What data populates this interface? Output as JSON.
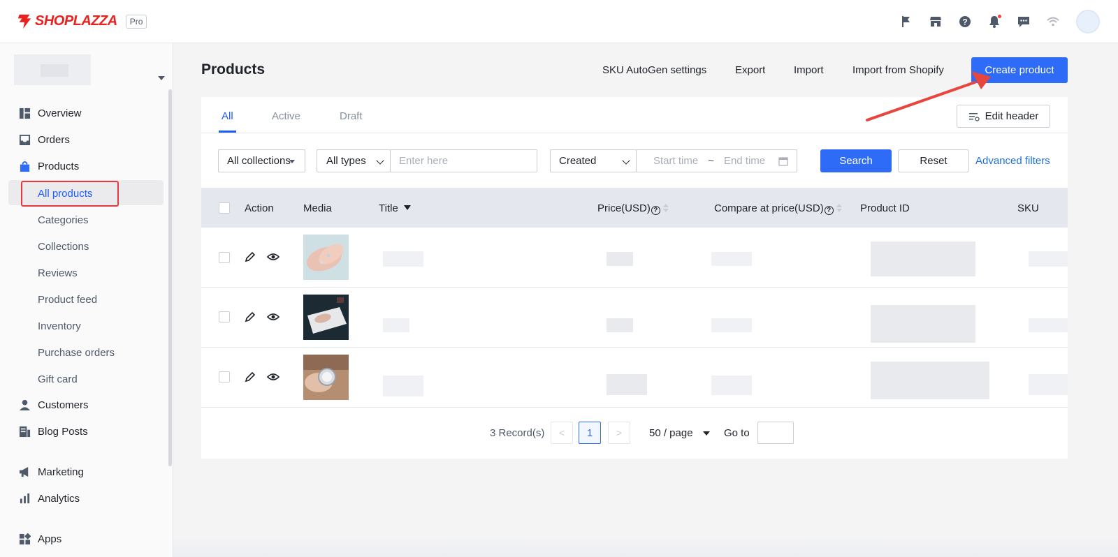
{
  "brand": {
    "name": "SHOPLAZZA",
    "badge": "Pro",
    "color": "#e8231f"
  },
  "topbar": {
    "icons": [
      "flag-icon",
      "store-icon",
      "help-icon",
      "bell-icon",
      "chat-icon",
      "wifi-icon"
    ]
  },
  "sidebar": {
    "items": [
      {
        "label": "Overview",
        "icon": "dashboard-icon"
      },
      {
        "label": "Orders",
        "icon": "inbox-icon"
      },
      {
        "label": "Products",
        "icon": "bag-icon"
      },
      {
        "label": "Customers",
        "icon": "person-icon"
      },
      {
        "label": "Blog Posts",
        "icon": "document-icon"
      },
      {
        "label": "Marketing",
        "icon": "megaphone-icon"
      },
      {
        "label": "Analytics",
        "icon": "bar-chart-icon"
      },
      {
        "label": "Apps",
        "icon": "apps-icon"
      }
    ],
    "sub_items": [
      {
        "label": "All products",
        "active": true
      },
      {
        "label": "Categories"
      },
      {
        "label": "Collections"
      },
      {
        "label": "Reviews"
      },
      {
        "label": "Product feed"
      },
      {
        "label": "Inventory"
      },
      {
        "label": "Purchase orders"
      },
      {
        "label": "Gift card"
      }
    ]
  },
  "header": {
    "title": "Products",
    "links": [
      "SKU AutoGen settings",
      "Export",
      "Import",
      "Import from Shopify"
    ],
    "create_label": "Create product",
    "accent": "#2e6bf6"
  },
  "tabs": [
    {
      "label": "All",
      "active": true
    },
    {
      "label": "Active"
    },
    {
      "label": "Draft"
    }
  ],
  "edit_header_label": "Edit header",
  "filters": {
    "collections": "All collections",
    "types": "All types",
    "search_placeholder": "Enter here",
    "date_field": "Created",
    "start_placeholder": "Start time",
    "separator": "~",
    "end_placeholder": "End time",
    "search_label": "Search",
    "reset_label": "Reset",
    "advanced_label": "Advanced filters"
  },
  "table": {
    "columns": {
      "action": "Action",
      "media": "Media",
      "title": "Title",
      "price": "Price(USD)",
      "compare": "Compare at price(USD)",
      "product_id": "Product ID",
      "sku": "SKU",
      "help_glyph": "?"
    },
    "rows": [
      {
        "media": "hands-rings-photo"
      },
      {
        "media": "hand-laptop-photo"
      },
      {
        "media": "wrist-watch-photo"
      }
    ]
  },
  "pagination": {
    "records": "3 Record(s)",
    "prev": "<",
    "current": "1",
    "next": ">",
    "per_page": "50 / page",
    "goto_label": "Go to"
  },
  "annotation": {
    "color": "#e8453c"
  }
}
